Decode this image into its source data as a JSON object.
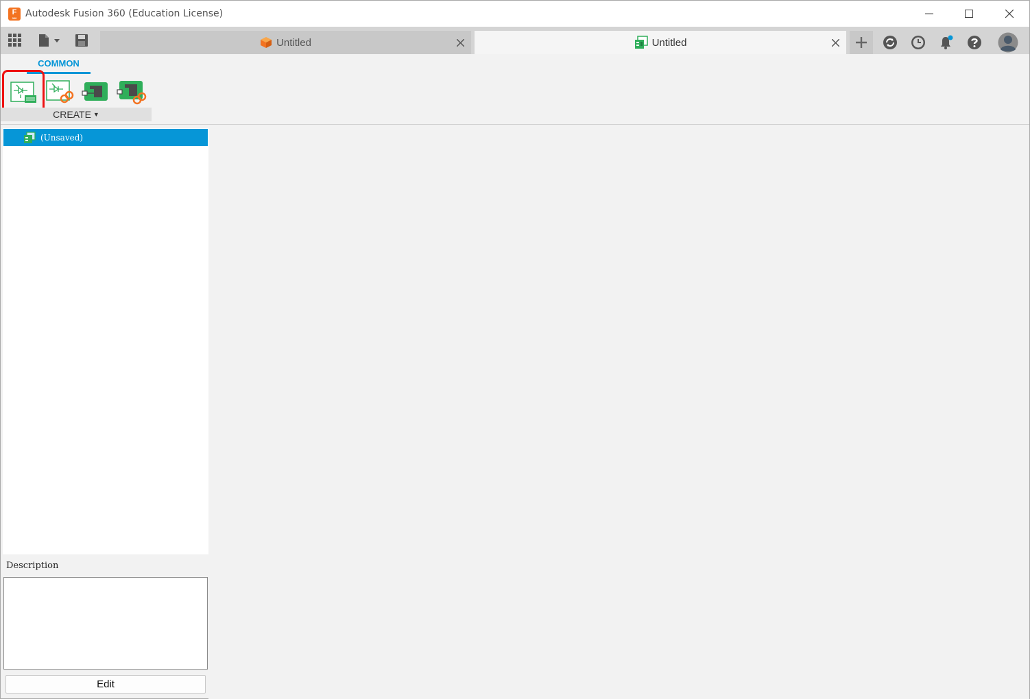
{
  "titlebar": {
    "app_logo_letter": "F",
    "app_logo_sub": "360",
    "title": "Autodesk Fusion 360 (Education License)",
    "controls": [
      "minimize-icon",
      "maximize-icon",
      "close-icon"
    ]
  },
  "tabstrip": {
    "left_tools": [
      "grid-icon",
      "file-icon",
      "save-icon"
    ],
    "tabs": [
      {
        "label": "Untitled",
        "icon": "design-cube-icon",
        "active": false
      },
      {
        "label": "Untitled",
        "icon": "electronics-design-icon",
        "active": true
      }
    ],
    "right_tools": [
      "plus-icon",
      "job-status-icon",
      "clock-icon",
      "notification-bell-icon",
      "help-icon",
      "user-avatar-icon"
    ]
  },
  "ribbon": {
    "tab": "COMMON",
    "tools": [
      "new-schematic-icon",
      "linked-schematic-icon",
      "new-pcb-icon",
      "linked-pcb-icon"
    ],
    "panel_label": "CREATE",
    "panel_caret": "▼"
  },
  "browser": {
    "items": [
      {
        "label": "(Unsaved)",
        "icon": "electronics-design-icon",
        "selected": true
      }
    ]
  },
  "description": {
    "label": "Description",
    "edit_button": "Edit"
  },
  "colors": {
    "accent": "#0696d7",
    "logo_orange": "#f37321",
    "highlight_red": "#e11111",
    "pcb_green": "#2fae5a"
  }
}
